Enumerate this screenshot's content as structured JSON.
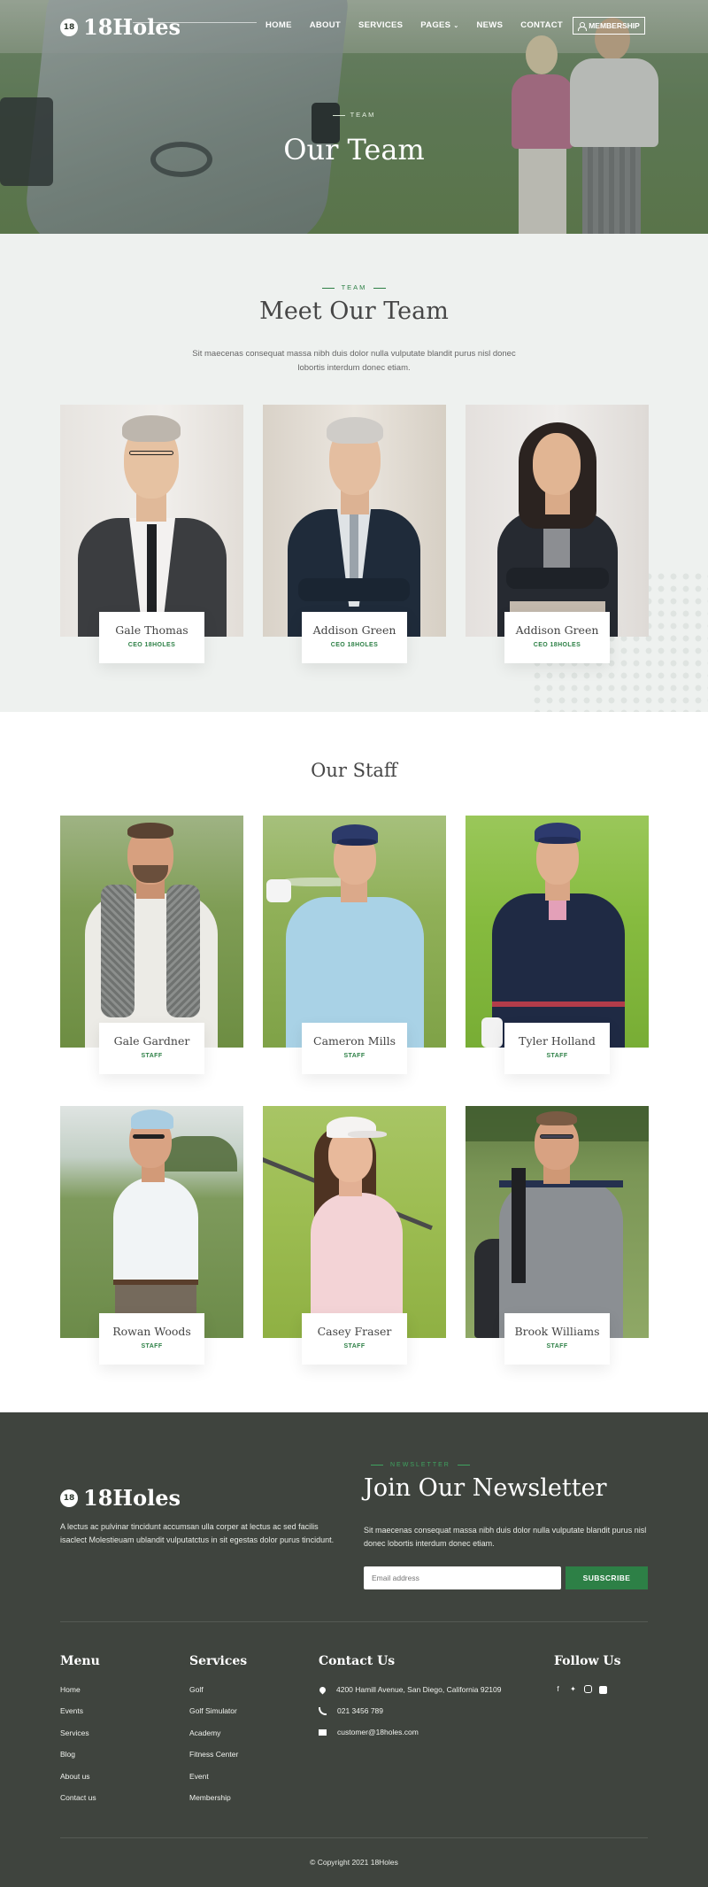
{
  "brand": {
    "name": "18Holes",
    "mark": "18"
  },
  "nav": {
    "items": [
      "HOME",
      "ABOUT",
      "SERVICES",
      "PAGES",
      "NEWS",
      "CONTACT"
    ],
    "pages_chevron": "⌄",
    "membership": "MEMBERSHIP"
  },
  "hero": {
    "eyebrow": "TEAM",
    "title": "Our Team"
  },
  "team": {
    "eyebrow": "TEAM",
    "title": "Meet Our Team",
    "description": "Sit maecenas consequat massa nibh duis dolor nulla vulputate blandit purus nisl donec lobortis interdum donec etiam.",
    "members": [
      {
        "name": "Gale Thomas",
        "role": "CEO 18HOLES"
      },
      {
        "name": "Addison Green",
        "role": "CEO 18HOLES"
      },
      {
        "name": "Addison Green",
        "role": "CEO 18HOLES"
      }
    ]
  },
  "staff": {
    "title": "Our Staff",
    "members": [
      {
        "name": "Gale Gardner",
        "role": "STAFF"
      },
      {
        "name": "Cameron Mills",
        "role": "STAFF"
      },
      {
        "name": "Tyler Holland",
        "role": "STAFF"
      },
      {
        "name": "Rowan Woods",
        "role": "STAFF"
      },
      {
        "name": "Casey Fraser",
        "role": "STAFF"
      },
      {
        "name": "Brook Williams",
        "role": "STAFF"
      }
    ]
  },
  "footer": {
    "about": "A lectus ac pulvinar tincidunt accumsan ulla corper at lectus ac sed facilis isaclect Molestieuam ublandit vulputatctus in sit egestas dolor purus tincidunt.",
    "newsletter": {
      "eyebrow": "NEWSLETTER",
      "title": "Join Our Newsletter",
      "description": "Sit maecenas consequat massa nibh duis dolor nulla vulputate blandit purus nisl donec lobortis interdum donec etiam.",
      "placeholder": "Email address",
      "button": "SUBSCRIBE"
    },
    "menu": {
      "title": "Menu",
      "items": [
        "Home",
        "Events",
        "Services",
        "Blog",
        "About us",
        "Contact us"
      ]
    },
    "services": {
      "title": "Services",
      "items": [
        "Golf",
        "Golf Simulator",
        "Academy",
        "Fitness Center",
        "Event",
        "Membership"
      ]
    },
    "contact": {
      "title": "Contact Us",
      "address": "4200 Hamill Avenue, San Diego, California 92109",
      "phone": "021 3456 789",
      "email": "customer@18holes.com"
    },
    "follow": {
      "title": "Follow Us",
      "icons": [
        "facebook-icon",
        "twitter-icon",
        "instagram-icon",
        "youtube-icon"
      ]
    },
    "copyright": "© Copyright 2021 18Holes"
  },
  "colors": {
    "accent": "#2d8046",
    "footer_bg": "#3f443e",
    "team_bg": "#eef1ef"
  }
}
